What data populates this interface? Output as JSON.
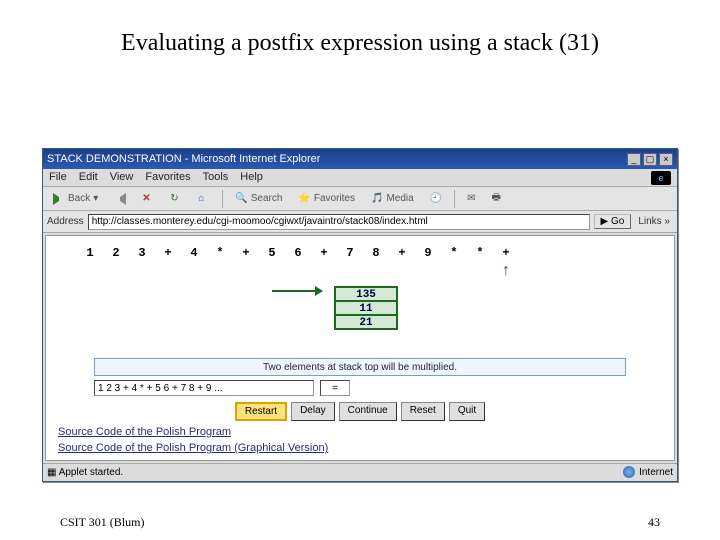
{
  "slide": {
    "title": "Evaluating a postfix expression using a stack (31)",
    "footer_left": "CSIT 301 (Blum)",
    "footer_right": "43"
  },
  "browser": {
    "window_title": "STACK DEMONSTRATION - Microsoft Internet Explorer",
    "menus": {
      "file": "File",
      "edit": "Edit",
      "view": "View",
      "favorites": "Favorites",
      "tools": "Tools",
      "help": "Help"
    },
    "toolbar": {
      "back": "Back",
      "search": "Search",
      "favorites": "Favorites",
      "media": "Media"
    },
    "address_label": "Address",
    "address_value": "http://classes.monterey.edu/cgi-moomoo/cgiwxt/javaintro/stack08/index.html",
    "go": "Go",
    "links": "Links »",
    "status_left": "Applet started.",
    "status_right": "Internet"
  },
  "applet": {
    "tokens": [
      "1",
      "2",
      "3",
      "+",
      "4",
      "*",
      "+",
      "5",
      "6",
      "+",
      "7",
      "8",
      "+",
      "9",
      "*",
      "*",
      "+"
    ],
    "tokens_str": "1  2  3  +  4  *  +  5  6  +  7  8  +  9  *  *  +",
    "pointer_index": 15,
    "stack": [
      "135",
      "11",
      "21"
    ],
    "message": "Two elements at stack top will be multiplied.",
    "expression_value": "1 2 3 + 4 * + 5 6 + 7 8 + 9 ...",
    "step_value": "=",
    "buttons": {
      "restart": "Restart",
      "delay": "Delay",
      "continue": "Continue",
      "reset": "Reset",
      "quit": "Quit"
    },
    "src1": "Source Code of the Polish Program",
    "src2": "Source Code of the Polish Program (Graphical Version)"
  }
}
